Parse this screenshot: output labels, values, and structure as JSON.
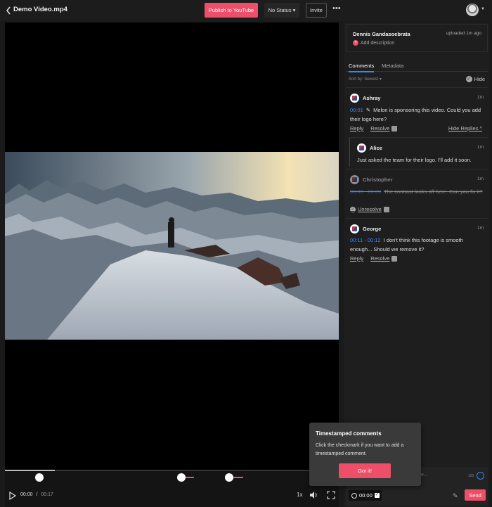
{
  "header": {
    "title": "Demo Video.mp4",
    "publish_label": "Publish to YouTube",
    "status_label": "No Status",
    "invite_label": "Invite",
    "more_label": "•••"
  },
  "player": {
    "current_time": "00:00",
    "separator": "/",
    "duration": "00:17",
    "speed": "1x",
    "progress_percent": 15
  },
  "owner": {
    "name": "Dennis Gandasoebrata",
    "uploaded": "uploaded 1m ago",
    "add_description": "Add description"
  },
  "tabs": {
    "comments": "Comments",
    "metadata": "Metadata"
  },
  "sort": {
    "label": "Sort by: Newest",
    "hide_label": "Hide"
  },
  "comments": [
    {
      "author": "Ashray",
      "time": "1m",
      "timestamp": "00:01",
      "text": "Melon is sponsoring this video. Could you add their logo here?",
      "reply_label": "Reply",
      "resolve_label": "Resolve",
      "hide_replies_label": "Hide Replies"
    },
    {
      "author": "Alice",
      "time": "1m",
      "text": "Just asked the team for their logo. I'll add it soon."
    },
    {
      "author": "Christopher",
      "time": "1m",
      "timestamp": "00:08 - 00:09",
      "text": "The contrast looks off here. Can you fix it?",
      "unresolve_label": "Unresolve"
    },
    {
      "author": "George",
      "time": "1m",
      "timestamp": "00:11 - 00:12",
      "text": "I don't think this footage is smooth enough... Should we remove it?",
      "reply_label": "Reply",
      "resolve_label": "Resolve"
    }
  ],
  "tooltip": {
    "title": "Timestamped comments",
    "body": "Click the checkmark if you want to add a timestamped comment.",
    "button": "Got it!"
  },
  "composer": {
    "placeholder": "e...",
    "char_count": "120",
    "timestamp": "00:00",
    "send_label": "Send"
  },
  "colors": {
    "accent": "#ee4f68",
    "link": "#3a86ff"
  }
}
